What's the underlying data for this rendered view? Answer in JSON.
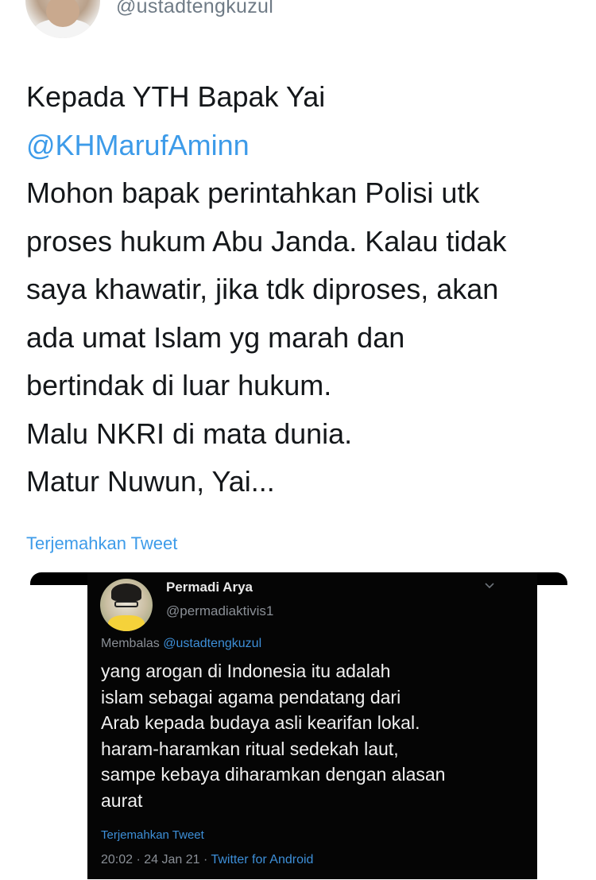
{
  "header": {
    "handle": "@ustadtengkuzul"
  },
  "tweet": {
    "lines": [
      "Kepada YTH Bapak Yai",
      "@KHMarufAminn",
      "Mohon bapak perintahkan Polisi utk",
      "proses hukum Abu Janda. Kalau tidak",
      "saya khawatir, jika tdk diproses, akan",
      "ada umat Islam yg marah dan",
      "bertindak di luar hukum.",
      "Malu NKRI di mata dunia.",
      "Matur Nuwun, Yai..."
    ],
    "translate": "Terjemahkan Tweet"
  },
  "embed": {
    "name": "Permadi Arya",
    "handle": "@permadiaktivis1",
    "reply_prefix": "Membalas ",
    "reply_mention": "@ustadtengkuzul",
    "lines": [
      "yang arogan di Indonesia itu adalah",
      "islam sebagai agama pendatang dari",
      "Arab kepada budaya asli kearifan lokal.",
      "haram-haramkan ritual sedekah laut,",
      "sampe kebaya diharamkan dengan alasan",
      "aurat"
    ],
    "translate": "Terjemahkan Tweet",
    "timestamp": "20:02 · 24 Jan 21 · ",
    "app": "Twitter for Android"
  },
  "colors": {
    "link": "#3d9be9",
    "text": "#14171a",
    "muted": "#6f7b86",
    "embed_bg": "#050505"
  },
  "icons": {
    "embed_menu": "chevron-down-icon"
  }
}
